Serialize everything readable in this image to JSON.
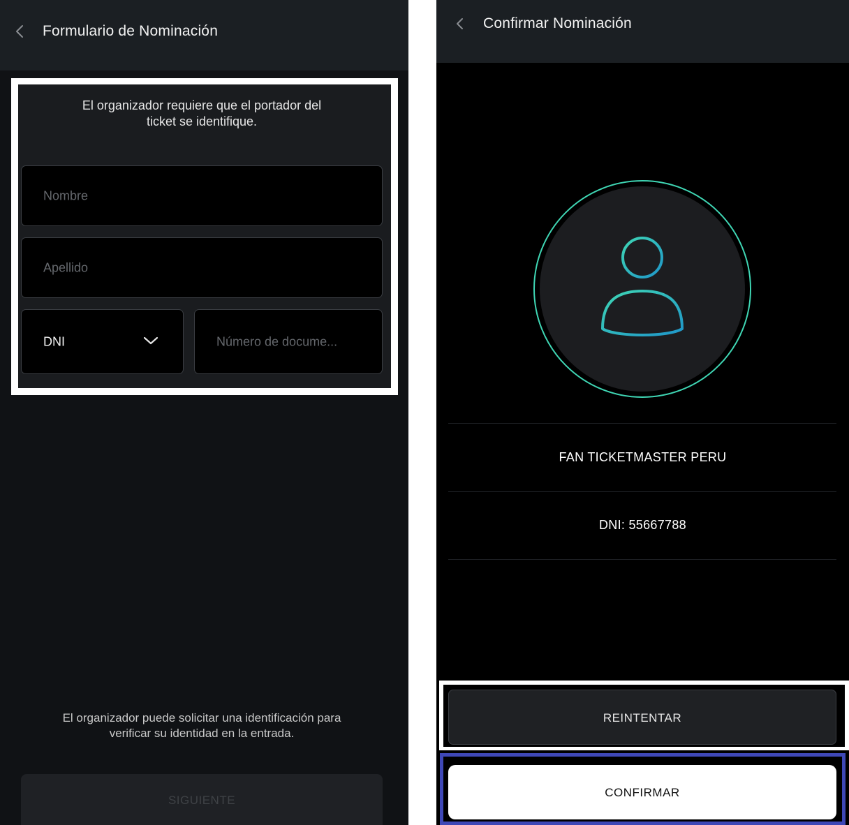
{
  "left_screen": {
    "header": {
      "title": "Formulario de Nominación",
      "back_icon": "chevron-left-icon"
    },
    "form": {
      "intro_line1": "El organizador requiere que el portador del",
      "intro_line2": "ticket se identifique.",
      "first_name_placeholder": "Nombre",
      "last_name_placeholder": "Apellido",
      "doc_type_selected": "DNI",
      "doc_number_placeholder": "Número de docume..."
    },
    "footer": {
      "note_line1": "El organizador puede solicitar una identificación para",
      "note_line2": "verificar su identidad en la entrada.",
      "next_label": "SIGUIENTE"
    }
  },
  "right_screen": {
    "header": {
      "title": "Confirmar Nominación",
      "back_icon": "chevron-left-icon"
    },
    "avatar": {
      "icon": "user-icon",
      "ring_color": "#3fd6b4",
      "figure_color": "#27a8c9"
    },
    "user": {
      "name": "FAN TICKETMASTER PERU",
      "document": "DNI: 55667788"
    },
    "actions": {
      "retry_label": "REINTENTAR",
      "confirm_label": "CONFIRMAR"
    }
  },
  "colors": {
    "left_background": "#101215",
    "header_background": "#1b1f23",
    "highlight_white": "#ffffff",
    "highlight_blue": "#3f48b7"
  }
}
